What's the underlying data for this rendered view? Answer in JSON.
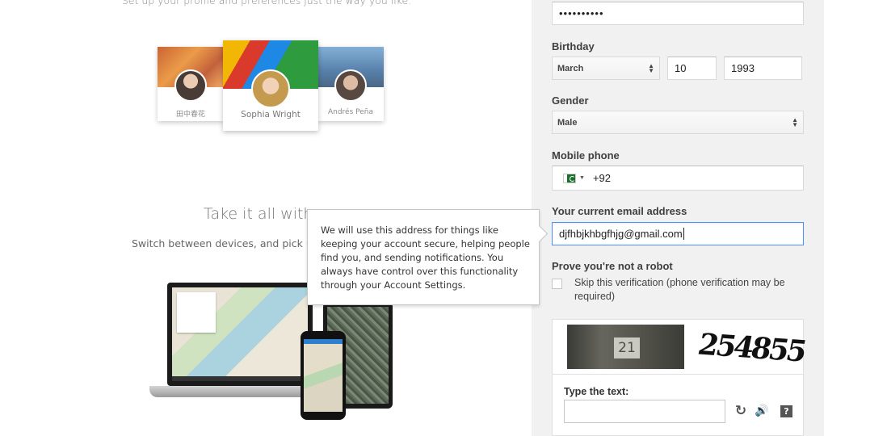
{
  "promo": {
    "top_text": "Set up your profile and preferences just the way you like.",
    "profiles": [
      {
        "name": "田中春花"
      },
      {
        "name": "Sophia Wright"
      },
      {
        "name": "Andrés Peña"
      }
    ],
    "heading": "Take it all with",
    "subtext": "Switch between devices, and pick up"
  },
  "tooltip": {
    "text": "We will use this address for things like keeping your account secure, helping people find you, and sending notifications. You always have control over this functionality through your Account Settings."
  },
  "form": {
    "password_value": "••••••••••",
    "birthday": {
      "label": "Birthday",
      "month": "March",
      "day": "10",
      "year": "1993"
    },
    "gender": {
      "label": "Gender",
      "value": "Male"
    },
    "mobile": {
      "label": "Mobile phone",
      "country_code": "+92"
    },
    "email": {
      "label": "Your current email address",
      "value": "djfhbjkhbgfhjg@gmail.com"
    },
    "robot": {
      "label": "Prove you're not a robot",
      "skip_label": "Skip this verification (phone verification may be required)"
    },
    "captcha": {
      "photo_number": "21",
      "distorted_text": "254855",
      "type_label": "Type the text:",
      "refresh_icon": "↻",
      "audio_icon": "🔊",
      "help_icon": "?"
    }
  }
}
